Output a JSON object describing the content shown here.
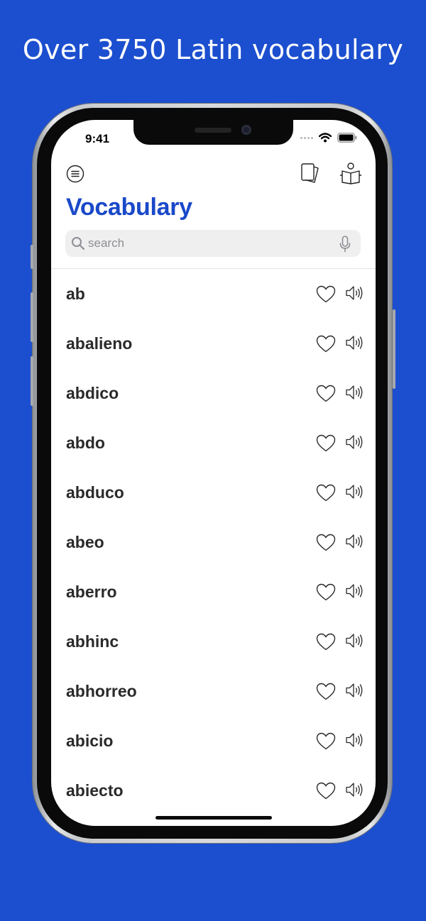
{
  "headline": "Over 3750 Latin vocabulary",
  "status_bar": {
    "time": "9:41",
    "icons": [
      "signal-dots-icon",
      "wifi-icon",
      "battery-icon"
    ]
  },
  "toolbar": {
    "left_icon": "menu-icon",
    "right_icons": [
      "flashcards-icon",
      "reading-icon"
    ]
  },
  "title": "Vocabulary",
  "search": {
    "placeholder": "search",
    "value": "",
    "icons": [
      "search-icon",
      "microphone-icon"
    ]
  },
  "words": [
    {
      "text": "ab"
    },
    {
      "text": "abalieno"
    },
    {
      "text": "abdico"
    },
    {
      "text": "abdo"
    },
    {
      "text": "abduco"
    },
    {
      "text": "abeo"
    },
    {
      "text": "aberro"
    },
    {
      "text": "abhinc"
    },
    {
      "text": "abhorreo"
    },
    {
      "text": "abicio"
    },
    {
      "text": "abiecto"
    }
  ],
  "row_icons": [
    "heart-icon",
    "speaker-icon"
  ],
  "colors": {
    "background": "#1c4fcf",
    "title": "#1a49c9",
    "word_text": "#2a2a2a"
  }
}
